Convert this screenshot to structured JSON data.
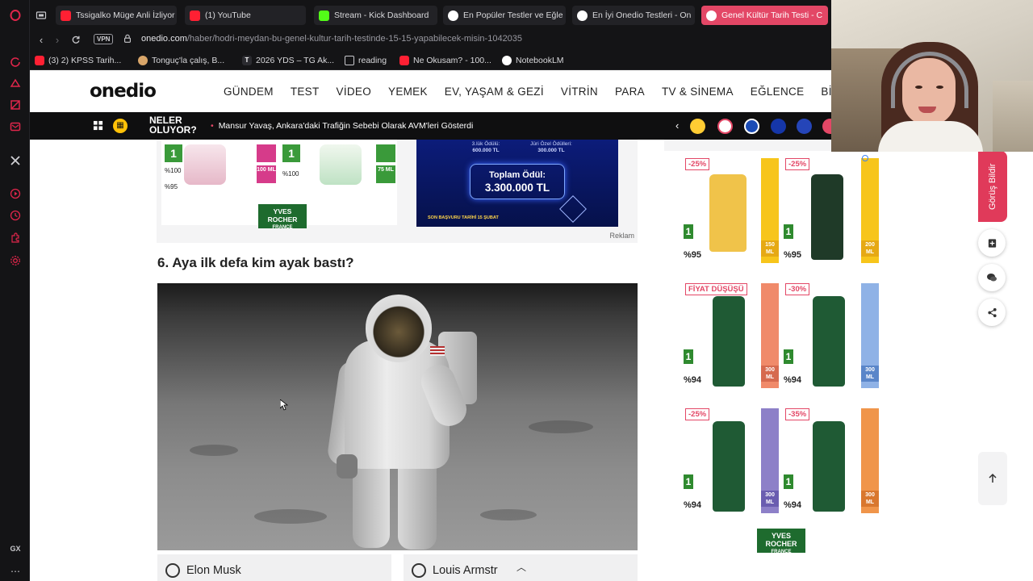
{
  "browser": {
    "tabs": [
      {
        "label": "Tssigalko Müge Anli İzliyor",
        "icon": "youtube-icon"
      },
      {
        "label": "(1) YouTube",
        "icon": "youtube-icon"
      },
      {
        "label": "Stream - Kick Dashboard",
        "icon": "kick-icon"
      },
      {
        "label": "En Popüler Testler ve Eğle",
        "icon": "onedio-icon"
      },
      {
        "label": "En İyi Onedio Testleri - On",
        "icon": "onedio-icon"
      },
      {
        "label": "Genel Kültür Tarih Testi - C",
        "icon": "onedio-icon",
        "active": true
      }
    ],
    "vpn_label": "VPN",
    "url_domain": "onedio.com",
    "url_path": "/haber/hodri-meydan-bu-genel-kultur-tarih-testinde-15-15-yapabilecek-misin-1042035",
    "bookmarks": [
      {
        "label": "(3) 2) KPSS Tarih...",
        "icon": "youtube-icon"
      },
      {
        "label": "Tonguç'la çalış, B...",
        "icon": "tonguc-icon"
      },
      {
        "label": "2026 YDS – TG Ak...",
        "icon": "tg-icon"
      },
      {
        "label": "reading",
        "icon": "folder-icon"
      },
      {
        "label": "Ne Okusam? - 100...",
        "icon": "youtube-icon"
      },
      {
        "label": "NotebookLM",
        "icon": "notebooklm-icon"
      }
    ],
    "sidebar_bottom_label": "GX"
  },
  "site": {
    "logo": "onedio",
    "nav": [
      "GÜNDEM",
      "TEST",
      "VİDEO",
      "YEMEK",
      "EV, YAŞAM & GEZİ",
      "VİTRİN",
      "PARA",
      "TV & SİNEMA",
      "EĞLENCE",
      "BİLGİSA"
    ],
    "ticker": {
      "label_line1": "NELER",
      "label_line2": "OLUYOR?",
      "headline": "Mansur Yavaş, Ankara'daki Trafiğin Sebebi Olarak AVM'leri Gösterdi"
    }
  },
  "article": {
    "ad": {
      "brand_line1": "YVES",
      "brand_line2": "ROCHER",
      "brand_line3": "FRANCE",
      "badge_1": "1",
      "price_1": "%100",
      "price_2": "%95",
      "ml_1": "100 ML",
      "ml_2": "75 ML",
      "contest_line1": "3.lük Ödülü:",
      "contest_val1": "600.000 TL",
      "contest_line2": "Jüri Özel Ödülleri:",
      "contest_val2": "300.000 TL",
      "total_label": "Toplam Ödül:",
      "total_value": "3.300.000 TL",
      "deadline": "SON BAŞVURU TARİHİ 15 ŞUBAT",
      "reklam": "Reklam"
    },
    "question": "6. Aya ilk defa kim ayak bastı?",
    "answers": [
      "Elon Musk",
      "Louis Armstr"
    ]
  },
  "rail": {
    "cells": [
      {
        "discount": "-25%",
        "price": "%95",
        "ml": "150 ML",
        "stripe": "#f7c51b",
        "bottle": "#f0c34a"
      },
      {
        "discount": "-25%",
        "price": "%95",
        "ml": "200 ML",
        "stripe": "#f7c51b",
        "bottle": "#1f3a28"
      },
      {
        "discount": "FİYAT DÜŞÜŞÜ",
        "price": "%94",
        "ml": "300 ML",
        "stripe": "#f08a6a",
        "bottle": "#1f5a34"
      },
      {
        "discount": "-30%",
        "price": "%94",
        "ml": "300 ML",
        "stripe": "#8fb2e6",
        "bottle": "#1f5a34"
      },
      {
        "discount": "-25%",
        "price": "%94",
        "ml": "300 ML",
        "stripe": "#8d80c8",
        "bottle": "#1f5a34"
      },
      {
        "discount": "-35%",
        "price": "%94",
        "ml": "300 ML",
        "stripe": "#f0954a",
        "bottle": "#1f5a34"
      }
    ],
    "badge": "1",
    "brand_line1": "YVES",
    "brand_line2": "ROCHER",
    "brand_line3": "FRANCE"
  },
  "floating": {
    "feedback": "Görüş Bildir"
  },
  "colors": {
    "accent": "#e34766",
    "ticker_bg": "#0f0f10",
    "browser_bg": "#141416"
  }
}
